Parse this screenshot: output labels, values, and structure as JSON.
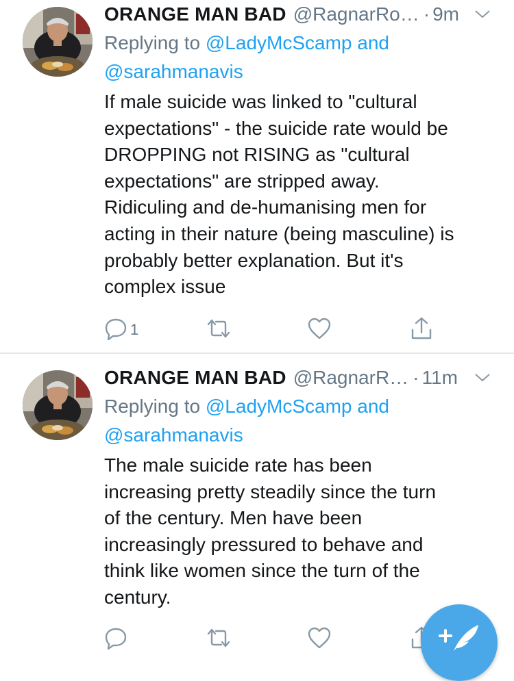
{
  "colors": {
    "text": "#14171a",
    "muted": "#657786",
    "link": "#1da1f2",
    "divider": "#e1e8ed",
    "fab": "#4aa8e8"
  },
  "tweets": [
    {
      "display_name": "ORANGE MAN BAD",
      "handle": "@RagnarRo…",
      "dot": "·",
      "time": "9m",
      "replying_to_label": "Replying to",
      "mention_1": "@LadyMcScamp",
      "mention_joiner": "and",
      "mention_2": "@sarahmanavis",
      "text": "If male suicide was linked to \"cultural\nexpectations\" - the suicide rate would be\nDROPPING not RISING as \"cultural\nexpectations\" are stripped away.\nRidiculing and de-humanising men for\nacting in their nature (being masculine) is\nprobably better explanation. But it's\ncomplex issue",
      "reply_count": "1",
      "icons": [
        "reply-icon",
        "retweet-icon",
        "like-icon",
        "share-icon",
        "chevron-down-icon"
      ]
    },
    {
      "display_name": "ORANGE MAN BAD",
      "handle": "@RagnarR…",
      "dot": "·",
      "time": "11m",
      "replying_to_label": "Replying to",
      "mention_1": "@LadyMcScamp",
      "mention_joiner": "and",
      "mention_2": "@sarahmanavis",
      "text": "The male suicide rate has been\nincreasing pretty steadily since the turn\nof the century. Men have been\nincreasingly pressured to behave and\nthink like women since the turn of the\ncentury.",
      "reply_count": "",
      "icons": [
        "reply-icon",
        "retweet-icon",
        "like-icon",
        "share-icon",
        "chevron-down-icon"
      ]
    }
  ],
  "compose": {
    "icon": "compose-tweet-icon",
    "glyph": "+"
  }
}
